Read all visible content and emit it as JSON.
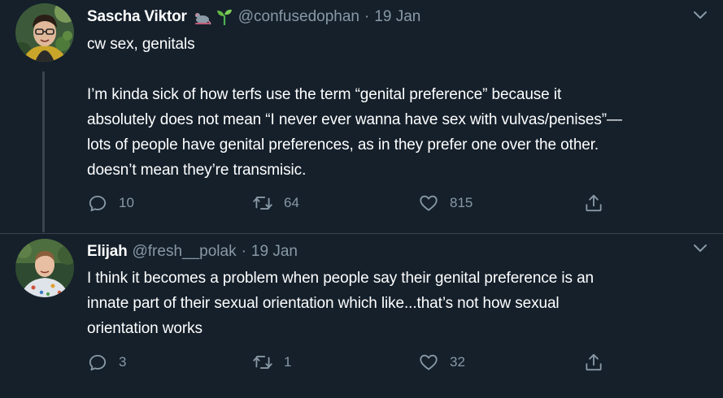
{
  "tweets": [
    {
      "author_name": "Sascha Viktor",
      "emojis": [
        "rat-emoji-icon",
        "seedling-emoji-icon"
      ],
      "handle": "@confusedophan",
      "separator": "·",
      "date": "19 Jan",
      "lines": [
        "cw sex, genitals",
        "",
        "I’m kinda sick of how terfs use the term “genital preference” because it",
        "absolutely does not mean “I never ever wanna have sex with vulvas/penises”—",
        "lots of people have genital preferences, as in they prefer one over the other.",
        "doesn’t mean they’re transmisic."
      ],
      "replies": "10",
      "retweets": "64",
      "likes": "815"
    },
    {
      "author_name": "Elijah",
      "handle": "@fresh__polak",
      "separator": "·",
      "date": "19 Jan",
      "lines": [
        "I think it becomes a problem when people say their genital preference is an",
        "innate part of their sexual orientation which like...that’s not how sexual",
        "orientation works"
      ],
      "replies": "3",
      "retweets": "1",
      "likes": "32"
    }
  ],
  "colors": {
    "background": "#15202b",
    "text_primary": "#ffffff",
    "text_secondary": "#8899a6",
    "divider": "#38444d"
  }
}
